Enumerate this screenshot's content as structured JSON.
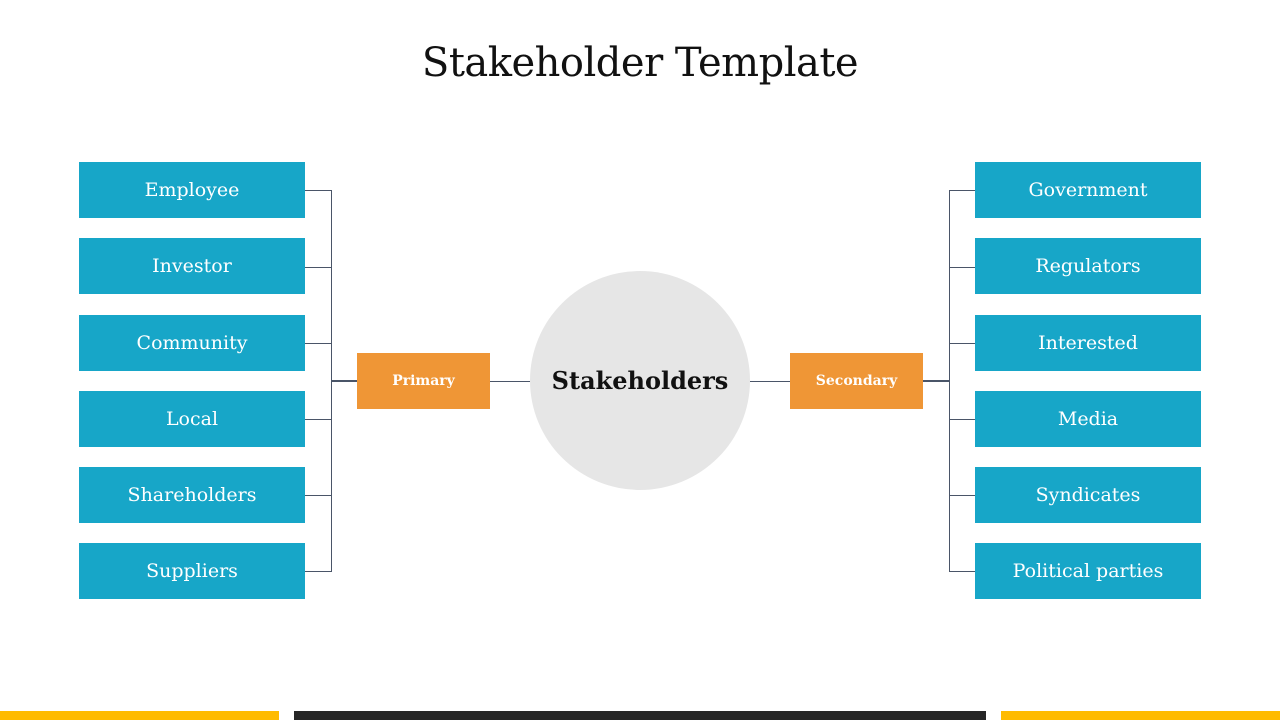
{
  "title": "Stakeholder Template",
  "center": {
    "label": "Stakeholders"
  },
  "primary": {
    "label": "Primary",
    "items": [
      "Employee",
      "Investor",
      "Community",
      "Local",
      "Shareholders",
      "Suppliers"
    ]
  },
  "secondary": {
    "label": "Secondary",
    "items": [
      "Government",
      "Regulators",
      "Interested",
      "Media",
      "Syndicates",
      "Political parties"
    ]
  },
  "colors": {
    "box": "#17a6c8",
    "category": "#ef9636",
    "circle": "#e6e6e6",
    "accent_bar": "#ffbb00",
    "dark_bar": "#262626"
  }
}
